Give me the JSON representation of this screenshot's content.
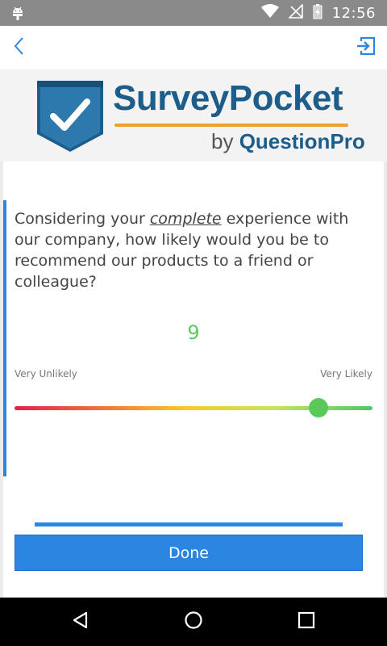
{
  "status_bar": {
    "time": "12:56",
    "icons": [
      "android-icon",
      "wifi-icon",
      "no-signal-icon",
      "battery-charging-icon"
    ]
  },
  "app_bar": {
    "icons": [
      "back-chevron-icon",
      "exit-icon"
    ],
    "accent_color": "#2a86e0"
  },
  "logo": {
    "title": "SurveyPocket",
    "sub_prefix": "by ",
    "sub_brand": "QuestionPro",
    "brand_color": "#1d5d8a",
    "underline_color": "#f0a030"
  },
  "question": {
    "text_before": "Considering your ",
    "text_emphasis": "complete",
    "text_after": " experience with our company, how likely would you be to recommend our products to a friend or colleague?"
  },
  "slider": {
    "value": "9",
    "min": 0,
    "max": 10,
    "value_fraction": 0.85,
    "label_min": "Very Unlikely",
    "label_max": "Very Likely",
    "value_color": "#5cc85c",
    "gradient_colors": [
      "#e0204a",
      "#f2743a",
      "#f8c82a",
      "#c8e45a",
      "#4ec86a"
    ]
  },
  "actions": {
    "done_label": "Done",
    "button_color": "#2a86e0"
  },
  "nav_bar": {
    "icons": [
      "back-triangle-icon",
      "home-circle-icon",
      "recents-square-icon"
    ]
  }
}
